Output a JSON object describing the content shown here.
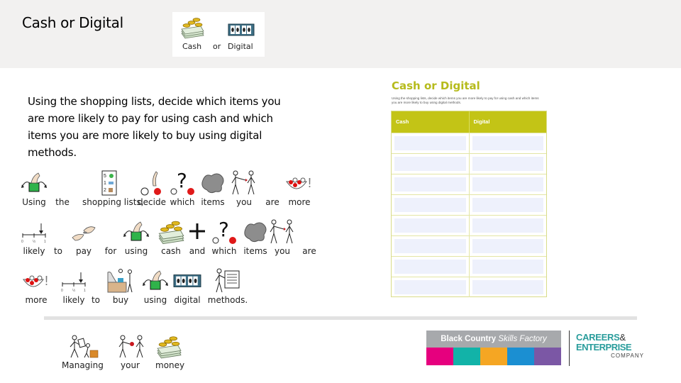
{
  "slide": {
    "title": "Cash or Digital",
    "title_symbols": [
      {
        "icon": "cash-icon",
        "label": "Cash"
      },
      {
        "icon": "",
        "label": "or"
      },
      {
        "icon": "digital-icon",
        "label": "Digital"
      }
    ],
    "instructions": "Using the shopping lists, decide which items you are more likely to pay for using cash and which items you are more likely to buy using digital methods."
  },
  "symbol_sentence": {
    "row1": [
      {
        "icon": "using-hand-icon",
        "label": "Using"
      },
      {
        "icon": "",
        "label": "the"
      },
      {
        "icon": "shopping-list-icon",
        "label": "shopping lists,"
      },
      {
        "icon": "decide-icon",
        "label": "decide"
      },
      {
        "icon": "which-question-icon",
        "label": "which"
      },
      {
        "icon": "items-blob-icon",
        "label": "items"
      },
      {
        "icon": "you-people-icon",
        "label": "you"
      },
      {
        "icon": "",
        "label": "are"
      },
      {
        "icon": "more-bowl-icon",
        "label": "more"
      }
    ],
    "row2": [
      {
        "icon": "likely-scale-icon",
        "label": "likely"
      },
      {
        "icon": "",
        "label": "to"
      },
      {
        "icon": "pay-hands-icon",
        "label": "pay"
      },
      {
        "icon": "",
        "label": "for"
      },
      {
        "icon": "using-hand-icon",
        "label": "using"
      },
      {
        "icon": "cash-icon",
        "label": "cash"
      },
      {
        "icon": "plus-icon",
        "label": "and"
      },
      {
        "icon": "which-question-icon",
        "label": "which"
      },
      {
        "icon": "items-blob-icon",
        "label": "items"
      },
      {
        "icon": "you-people-icon",
        "label": "you"
      },
      {
        "icon": "",
        "label": "are"
      }
    ],
    "row3": [
      {
        "icon": "more-bowl-icon",
        "label": "more"
      },
      {
        "icon": "likely-scale-icon",
        "label": "likely"
      },
      {
        "icon": "",
        "label": "to"
      },
      {
        "icon": "buy-shop-icon",
        "label": "buy"
      },
      {
        "icon": "using-hand-icon",
        "label": "using"
      },
      {
        "icon": "digital-icon",
        "label": "digital"
      },
      {
        "icon": "methods-board-icon",
        "label": "methods."
      }
    ]
  },
  "worksheet": {
    "title": "Cash or Digital",
    "description": "Using the shopping lists, decide which items you are more likely to pay for using cash and which items you are more likely to buy using digital methods.",
    "columns": [
      "Cash",
      "Digital"
    ],
    "empty_rows": 8,
    "accent_color": "#c3c416"
  },
  "footer": {
    "symbols": [
      {
        "icon": "managing-icon",
        "label": "Managing"
      },
      {
        "icon": "your-people-icon",
        "label": "your"
      },
      {
        "icon": "cash-icon",
        "label": "money"
      }
    ],
    "logo_bcsf": {
      "text_bold": "Black Country ",
      "text_italic": "Skills Factory",
      "stripe_colors": [
        "#e6007e",
        "#12b3a8",
        "#f5a623",
        "#1b8fd2",
        "#7b57a5"
      ]
    },
    "logo_cec": {
      "line1": "CAREERS",
      "amp": "&",
      "line2": "ENTERPRISE",
      "line3": "COMPANY"
    }
  }
}
